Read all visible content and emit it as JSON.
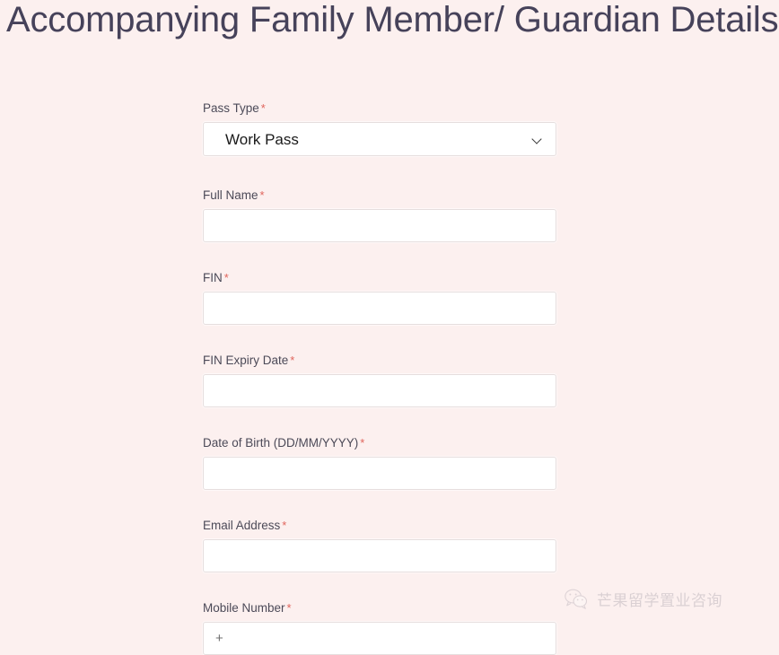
{
  "page": {
    "title": "Accompanying Family Member/ Guardian Details",
    "background_color": "#fcf0ef",
    "title_color": "#46425a",
    "required_marker_color": "#e0655c",
    "required_marker": "*"
  },
  "form": {
    "fields": [
      {
        "name": "pass-type",
        "label": "Pass Type",
        "required": true,
        "type": "select",
        "value": "Work Pass",
        "placeholder": "",
        "icon": "chevron-down-icon"
      },
      {
        "name": "full-name",
        "label": "Full Name",
        "required": true,
        "type": "text",
        "value": "",
        "placeholder": ""
      },
      {
        "name": "fin",
        "label": "FIN",
        "required": true,
        "type": "text",
        "value": "",
        "placeholder": ""
      },
      {
        "name": "fin-expiry-date",
        "label": "FIN Expiry Date",
        "required": true,
        "type": "text",
        "value": "",
        "placeholder": ""
      },
      {
        "name": "date-of-birth",
        "label": "Date of Birth (DD/MM/YYYY)",
        "required": true,
        "type": "text",
        "value": "",
        "placeholder": ""
      },
      {
        "name": "email-address",
        "label": "Email Address",
        "required": true,
        "type": "text",
        "value": "",
        "placeholder": ""
      },
      {
        "name": "mobile-number",
        "label": "Mobile Number",
        "required": true,
        "type": "text",
        "value": "+",
        "placeholder": "+"
      }
    ]
  },
  "watermark": {
    "text": "芒果留学置业咨询",
    "icon": "wechat-logo-icon"
  }
}
